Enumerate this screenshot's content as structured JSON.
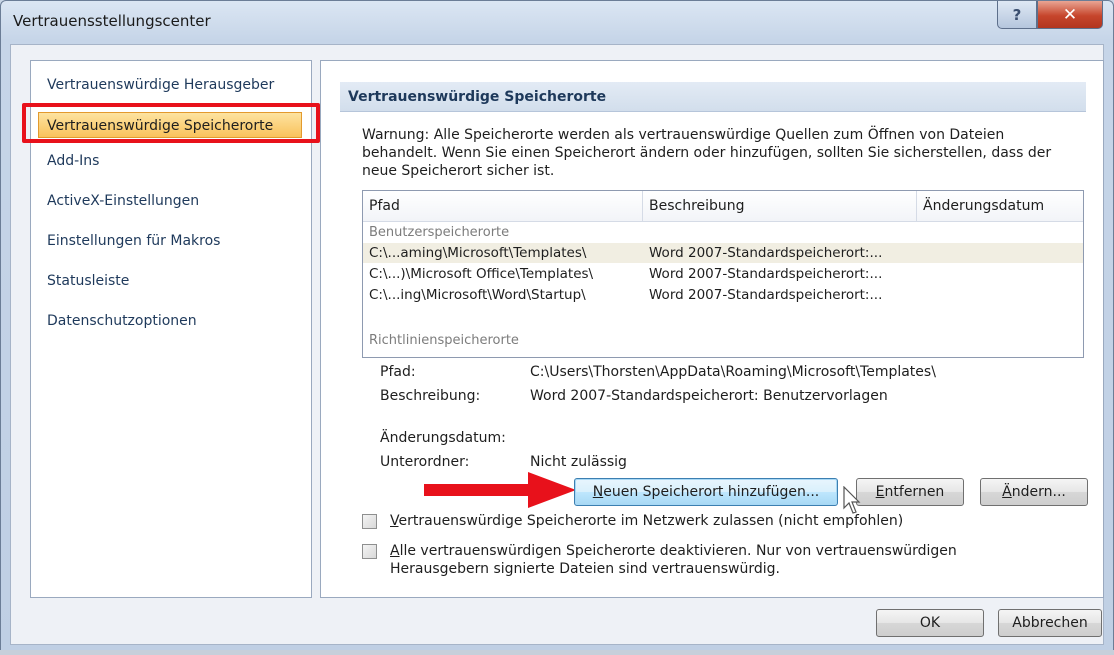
{
  "window": {
    "title": "Vertrauensstellungscenter",
    "help_glyph": "?",
    "close_glyph": "✕"
  },
  "nav": {
    "items": [
      {
        "label": "Vertrauenswürdige Herausgeber"
      },
      {
        "label": "Vertrauenswürdige Speicherorte",
        "selected": true
      },
      {
        "label": "Add-Ins"
      },
      {
        "label": "ActiveX-Einstellungen"
      },
      {
        "label": "Einstellungen für Makros"
      },
      {
        "label": "Statusleiste"
      },
      {
        "label": "Datenschutzoptionen"
      }
    ]
  },
  "section": {
    "title": "Vertrauenswürdige Speicherorte",
    "warning": "Warnung: Alle Speicherorte werden als vertrauenswürdige Quellen zum Öffnen von Dateien behandelt. Wenn Sie einen Speicherort ändern oder hinzufügen, sollten Sie sicherstellen, dass der neue Speicherort sicher ist."
  },
  "table": {
    "columns": [
      "Pfad",
      "Beschreibung",
      "Änderungsdatum"
    ],
    "group_user": "Benutzerspeicherorte",
    "rows": [
      {
        "path": "C:\\...aming\\Microsoft\\Templates\\",
        "description": "Word 2007-Standardspeicherort:...",
        "date": ""
      },
      {
        "path": "C:\\...)\\Microsoft Office\\Templates\\",
        "description": "Word 2007-Standardspeicherort:...",
        "date": ""
      },
      {
        "path": "C:\\...ing\\Microsoft\\Word\\Startup\\",
        "description": "Word 2007-Standardspeicherort:...",
        "date": ""
      }
    ],
    "group_policy": "Richtlinienspeicherorte"
  },
  "details": {
    "path_label": "Pfad:",
    "path_value": "C:\\Users\\Thorsten\\AppData\\Roaming\\Microsoft\\Templates\\",
    "description_label": "Beschreibung:",
    "description_value": "Word 2007-Standardspeicherort: Benutzervorlagen",
    "date_label": "Änderungsdatum:",
    "subfolder_label": "Unterordner:",
    "subfolder_value": "Nicht zulässig"
  },
  "buttons": {
    "add_rest": "euen Speicherort hinzufügen...",
    "add_mnemonic": "N",
    "remove_rest": "ntfernen",
    "remove_mnemonic": "E",
    "change_rest": "ndern...",
    "change_mnemonic": "Ä",
    "ok": "OK",
    "cancel": "Abbrechen"
  },
  "checkboxes": {
    "network_mnemonic": "V",
    "network_rest": "ertrauenswürdige Speicherorte im Netzwerk zulassen (nicht empfohlen)",
    "network_checked": false,
    "disable_mnemonic": "A",
    "disable_rest": "lle vertrauenswürdigen Speicherorte deaktivieren. Nur von vertrauenswürdigen Herausgebern signierte Dateien sind vertrauenswürdig.",
    "disable_checked": false
  },
  "colors": {
    "highlight_red": "#e8111b",
    "nav_selected": "#f9c25c"
  }
}
